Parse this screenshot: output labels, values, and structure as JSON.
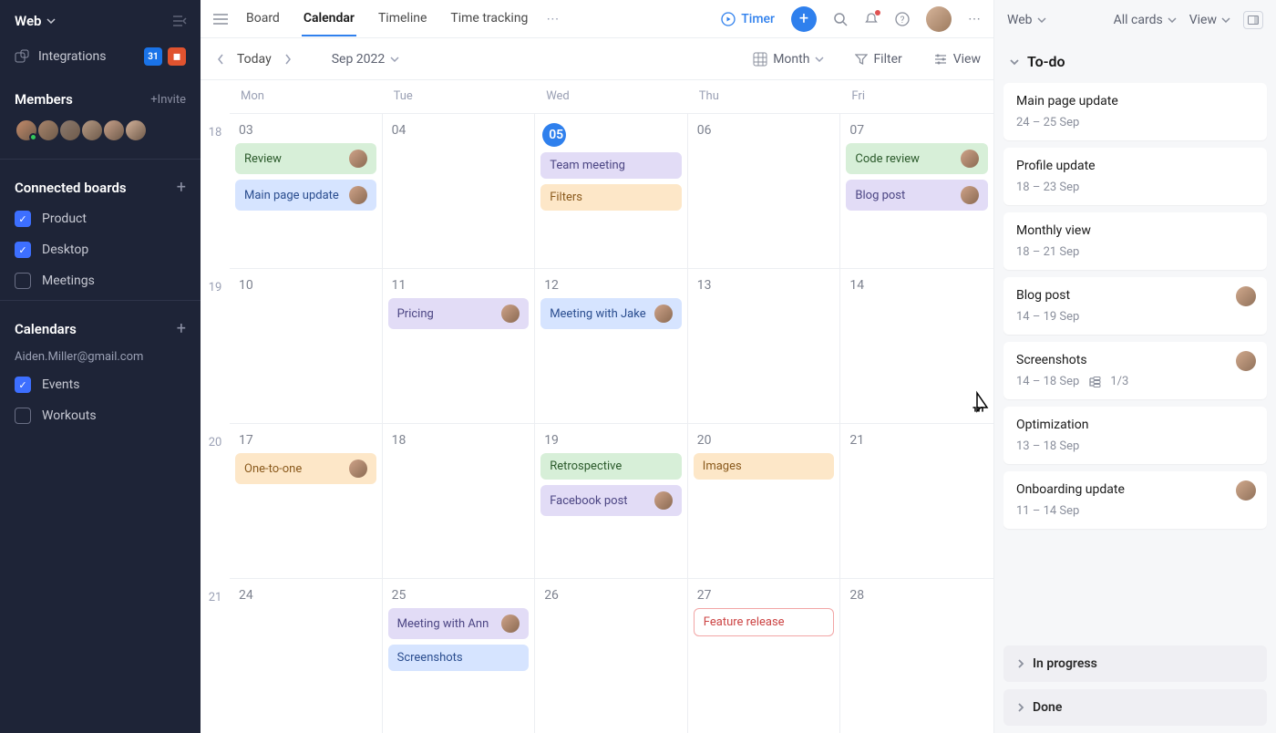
{
  "sidebar": {
    "workspace": "Web",
    "integrations_label": "Integrations",
    "members": {
      "title": "Members",
      "invite": "+Invite",
      "count": 6
    },
    "connected": {
      "title": "Connected boards",
      "items": [
        {
          "label": "Product",
          "checked": true
        },
        {
          "label": "Desktop",
          "checked": true
        },
        {
          "label": "Meetings",
          "checked": false
        }
      ]
    },
    "calendars": {
      "title": "Calendars",
      "email": "Aiden.Miller@gmail.com",
      "items": [
        {
          "label": "Events",
          "checked": true
        },
        {
          "label": "Workouts",
          "checked": false
        }
      ]
    }
  },
  "topbar": {
    "tabs": [
      "Board",
      "Calendar",
      "Timeline",
      "Time tracking"
    ],
    "active": "Calendar",
    "timer": "Timer"
  },
  "toolbar": {
    "today": "Today",
    "period": "Sep 2022",
    "granularity": "Month",
    "filter": "Filter",
    "view": "View"
  },
  "calendar": {
    "day_headers": [
      "Mon",
      "Tue",
      "Wed",
      "Thu",
      "Fri"
    ],
    "weeks": [
      {
        "wk": "18",
        "days": [
          {
            "n": "03",
            "events": [
              {
                "t": "Review",
                "c": "c-green",
                "av": true
              },
              {
                "t": "Main page update",
                "c": "c-blue",
                "av": true
              }
            ]
          },
          {
            "n": "04",
            "events": []
          },
          {
            "n": "05",
            "today": true,
            "events": [
              {
                "t": "Team meeting",
                "c": "c-purp"
              },
              {
                "t": "Filters",
                "c": "c-orng"
              }
            ]
          },
          {
            "n": "06",
            "events": []
          },
          {
            "n": "07",
            "events": [
              {
                "t": "Code review",
                "c": "c-green",
                "av": true
              },
              {
                "t": "Blog post",
                "c": "c-purp",
                "av": true
              }
            ]
          }
        ]
      },
      {
        "wk": "19",
        "days": [
          {
            "n": "10",
            "events": []
          },
          {
            "n": "11",
            "events": [
              {
                "t": "Pricing",
                "c": "c-purp",
                "av": true
              }
            ]
          },
          {
            "n": "12",
            "events": [
              {
                "t": "Meeting with Jake",
                "c": "c-blue",
                "av": true
              }
            ]
          },
          {
            "n": "13",
            "events": []
          },
          {
            "n": "14",
            "events": []
          }
        ]
      },
      {
        "wk": "20",
        "days": [
          {
            "n": "17",
            "events": [
              {
                "t": "One-to-one",
                "c": "c-orng",
                "av": true
              }
            ]
          },
          {
            "n": "18",
            "events": []
          },
          {
            "n": "19",
            "events": [
              {
                "t": "Retrospective",
                "c": "c-green"
              },
              {
                "t": "Facebook post",
                "c": "c-purp",
                "av": true
              }
            ]
          },
          {
            "n": "20",
            "events": [
              {
                "t": "Images",
                "c": "c-orng"
              }
            ]
          },
          {
            "n": "21",
            "events": []
          }
        ]
      },
      {
        "wk": "21",
        "days": [
          {
            "n": "24",
            "events": []
          },
          {
            "n": "25",
            "events": [
              {
                "t": "Meeting with Ann",
                "c": "c-purp",
                "av": true
              },
              {
                "t": "Screenshots",
                "c": "c-blue"
              }
            ]
          },
          {
            "n": "26",
            "events": []
          },
          {
            "n": "27",
            "events": [
              {
                "t": "Feature release",
                "c": "c-red"
              }
            ]
          },
          {
            "n": "28",
            "events": []
          }
        ]
      }
    ]
  },
  "rpanel": {
    "workspace": "Web",
    "filters": {
      "cards": "All cards",
      "view": "View"
    },
    "sections": {
      "todo": {
        "title": "To-do",
        "cards": [
          {
            "title": "Main page update",
            "sub": "24 – 25 Sep"
          },
          {
            "title": "Profile update",
            "sub": "18 – 23 Sep"
          },
          {
            "title": "Monthly view",
            "sub": "18 – 21 Sep"
          },
          {
            "title": "Blog post",
            "sub": "14 – 19 Sep",
            "av": true
          },
          {
            "title": "Screenshots",
            "sub": "14 – 18 Sep",
            "extra": "1/3",
            "av": true
          },
          {
            "title": "Optimization",
            "sub": "13 – 18 Sep"
          },
          {
            "title": "Onboarding update",
            "sub": "11 – 14 Sep",
            "av": true
          }
        ]
      },
      "inprogress": {
        "title": "In progress"
      },
      "done": {
        "title": "Done"
      }
    }
  }
}
